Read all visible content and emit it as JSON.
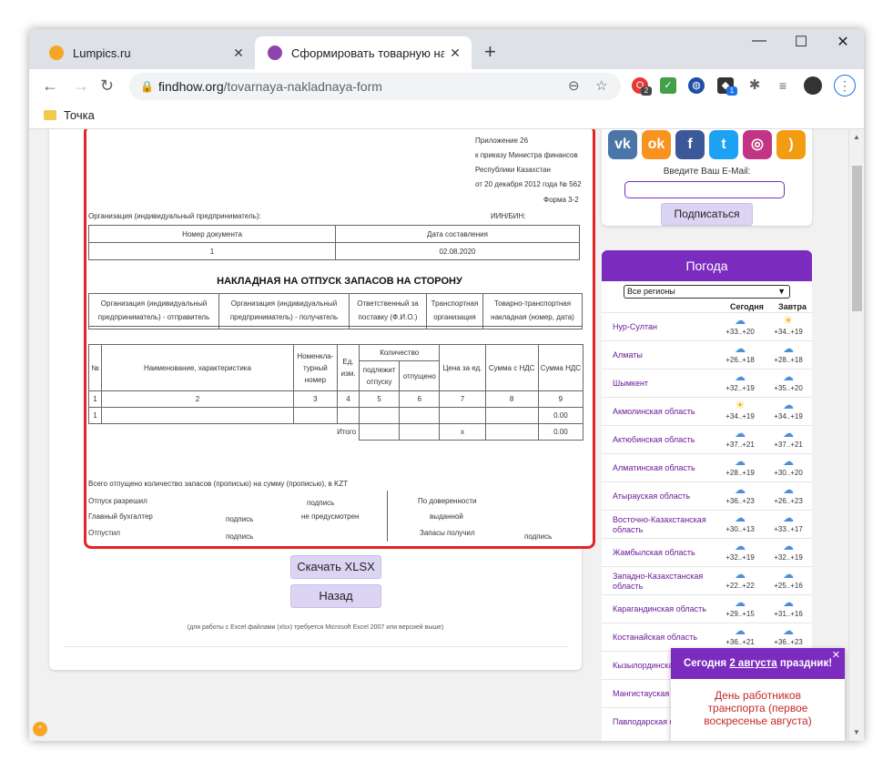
{
  "browser": {
    "tabs": [
      {
        "title": "Lumpics.ru",
        "close": "✕"
      },
      {
        "title": "Сформировать товарную накла",
        "close": "✕"
      }
    ],
    "new_tab": "+",
    "window_controls": {
      "minimize": "—",
      "maximize": "☐",
      "close": "✕"
    },
    "url_host": "findhow.org",
    "url_path": "/tovarnaya-nakladnaya-form",
    "bookmark": "Точка",
    "ext_badges": {
      "opera": "2",
      "cube": "1"
    }
  },
  "form": {
    "header_lines": [
      "Приложение 26",
      "к приказу Министра финансов",
      "Республики Казахстан",
      "от 20 декабря 2012 года № 562",
      "Форма 3-2"
    ],
    "org_label": "Организация (индивидуальный предприниматель):",
    "iin_label": "ИИН/БИН:",
    "doc_table": {
      "headers": [
        "Номер документа",
        "Дата составления"
      ],
      "values": [
        "1",
        "02.08.2020"
      ]
    },
    "title": "НАКЛАДНАЯ НА ОТПУСК ЗАПАСОВ НА СТОРОНУ",
    "parties": {
      "sender": [
        "Организация (индивидуальный",
        "предприниматель) - отправитель"
      ],
      "receiver": [
        "Организация (индивидуальный",
        "предприниматель) - получатель"
      ],
      "responsible": [
        "Ответственный за",
        "поставку (Ф.И.О.)"
      ],
      "transport": [
        "Транспортная",
        "организация"
      ],
      "ttn": [
        "Товарно-транспортная",
        "накладная (номер, дата)"
      ]
    },
    "items_table": {
      "col_no": "№",
      "col_name": "Наименование, характеристика",
      "col_nom": [
        "Номенкла-",
        "турный",
        "номер"
      ],
      "col_unit": [
        "Ед.",
        "изм."
      ],
      "col_qty": "Количество",
      "col_qty_due": [
        "подлежит",
        "отпуску"
      ],
      "col_qty_rel": [
        "отпущено"
      ],
      "col_price": "Цена за ед.",
      "col_sum_vat": "Сумма с НДС",
      "col_vat": "Сумма НДС",
      "col_numbers": [
        "1",
        "2",
        "3",
        "4",
        "5",
        "6",
        "7",
        "8",
        "9"
      ],
      "row_no": "1",
      "row_vat": "0.00",
      "total_label": "Итого",
      "total_price": "х",
      "total_vat": "0.00"
    },
    "signatures": {
      "total_text": "Всего отпущено количество запасов (прописью) на сумму (прописью), в KZT",
      "release_allowed": "Отпуск разрешил",
      "signature": "подпись",
      "chief_accountant": "Главный бухгалтер",
      "not_provided": "не предусмотрен",
      "released_by": "Отпустил",
      "by_proxy": "По доверенности",
      "issued": "выданной",
      "received_by": "Запасы получил"
    }
  },
  "buttons": {
    "download": "Скачать XLSX",
    "back": "Назад"
  },
  "note": "(для работы с Excel файлами (xlsx) требуется Microsoft Excel 2007 или версией выше)",
  "sidebar": {
    "email_label": "Введите Ваш E-Mail:",
    "subscribe": "Подписаться",
    "social": [
      "vk",
      "ok",
      "facebook",
      "twitter",
      "instagram",
      "rss"
    ]
  },
  "weather": {
    "title": "Погода",
    "region_select": "Все регионы",
    "col_today": "Сегодня",
    "col_tomorrow": "Завтра",
    "rows": [
      {
        "name": "Нур-Султан",
        "today": "+33..+20",
        "today_icon": "cloud",
        "tomorrow": "+34..+19",
        "tomorrow_icon": "sun"
      },
      {
        "name": "Алматы",
        "today": "+26..+18",
        "today_icon": "cloud",
        "tomorrow": "+28..+18",
        "tomorrow_icon": "cloud"
      },
      {
        "name": "Шымкент",
        "today": "+32..+19",
        "today_icon": "cloud",
        "tomorrow": "+35..+20",
        "tomorrow_icon": "cloud"
      },
      {
        "name": "Акмолинская область",
        "today": "+34..+19",
        "today_icon": "sun",
        "tomorrow": "+34..+19",
        "tomorrow_icon": "cloud"
      },
      {
        "name": "Актюбинская область",
        "today": "+37..+21",
        "today_icon": "cloud",
        "tomorrow": "+37..+21",
        "tomorrow_icon": "cloud"
      },
      {
        "name": "Алматинская область",
        "today": "+28..+19",
        "today_icon": "cloud",
        "tomorrow": "+30..+20",
        "tomorrow_icon": "cloud"
      },
      {
        "name": "Атырауская область",
        "today": "+36..+23",
        "today_icon": "cloud",
        "tomorrow": "+26..+23",
        "tomorrow_icon": "cloud"
      },
      {
        "name": "Восточно-Казахстанская область",
        "today": "+30..+13",
        "today_icon": "cloud",
        "tomorrow": "+33..+17",
        "tomorrow_icon": "cloud"
      },
      {
        "name": "Жамбылская область",
        "today": "+32..+19",
        "today_icon": "cloud",
        "tomorrow": "+32..+19",
        "tomorrow_icon": "cloud"
      },
      {
        "name": "Западно-Казахстанская область",
        "today": "+22..+22",
        "today_icon": "cloud",
        "tomorrow": "+25..+16",
        "tomorrow_icon": "cloud"
      },
      {
        "name": "Карагандинская область",
        "today": "+29..+15",
        "today_icon": "cloud",
        "tomorrow": "+31..+16",
        "tomorrow_icon": "cloud"
      },
      {
        "name": "Костанайская область",
        "today": "+36..+21",
        "today_icon": "cloud",
        "tomorrow": "+36..+23",
        "tomorrow_icon": "cloud"
      },
      {
        "name": "Кызылординская",
        "today": "",
        "today_icon": "",
        "tomorrow": "",
        "tomorrow_icon": ""
      },
      {
        "name": "Мангистауская о",
        "today": "",
        "today_icon": "",
        "tomorrow": "",
        "tomorrow_icon": ""
      },
      {
        "name": "Павлодарская о",
        "today": "",
        "today_icon": "",
        "tomorrow": "",
        "tomorrow_icon": ""
      }
    ]
  },
  "popup": {
    "prefix": "Сегодня ",
    "date": "2 августа",
    "suffix": " праздник!",
    "close": "✕",
    "holiday": [
      "День работников",
      "транспорта (первое",
      "воскресенье августа)"
    ]
  },
  "colors": {
    "accent": "#7b2cbf",
    "frame": "#e52224",
    "button": "#dcd4f3",
    "popup_text": "#c62828"
  }
}
